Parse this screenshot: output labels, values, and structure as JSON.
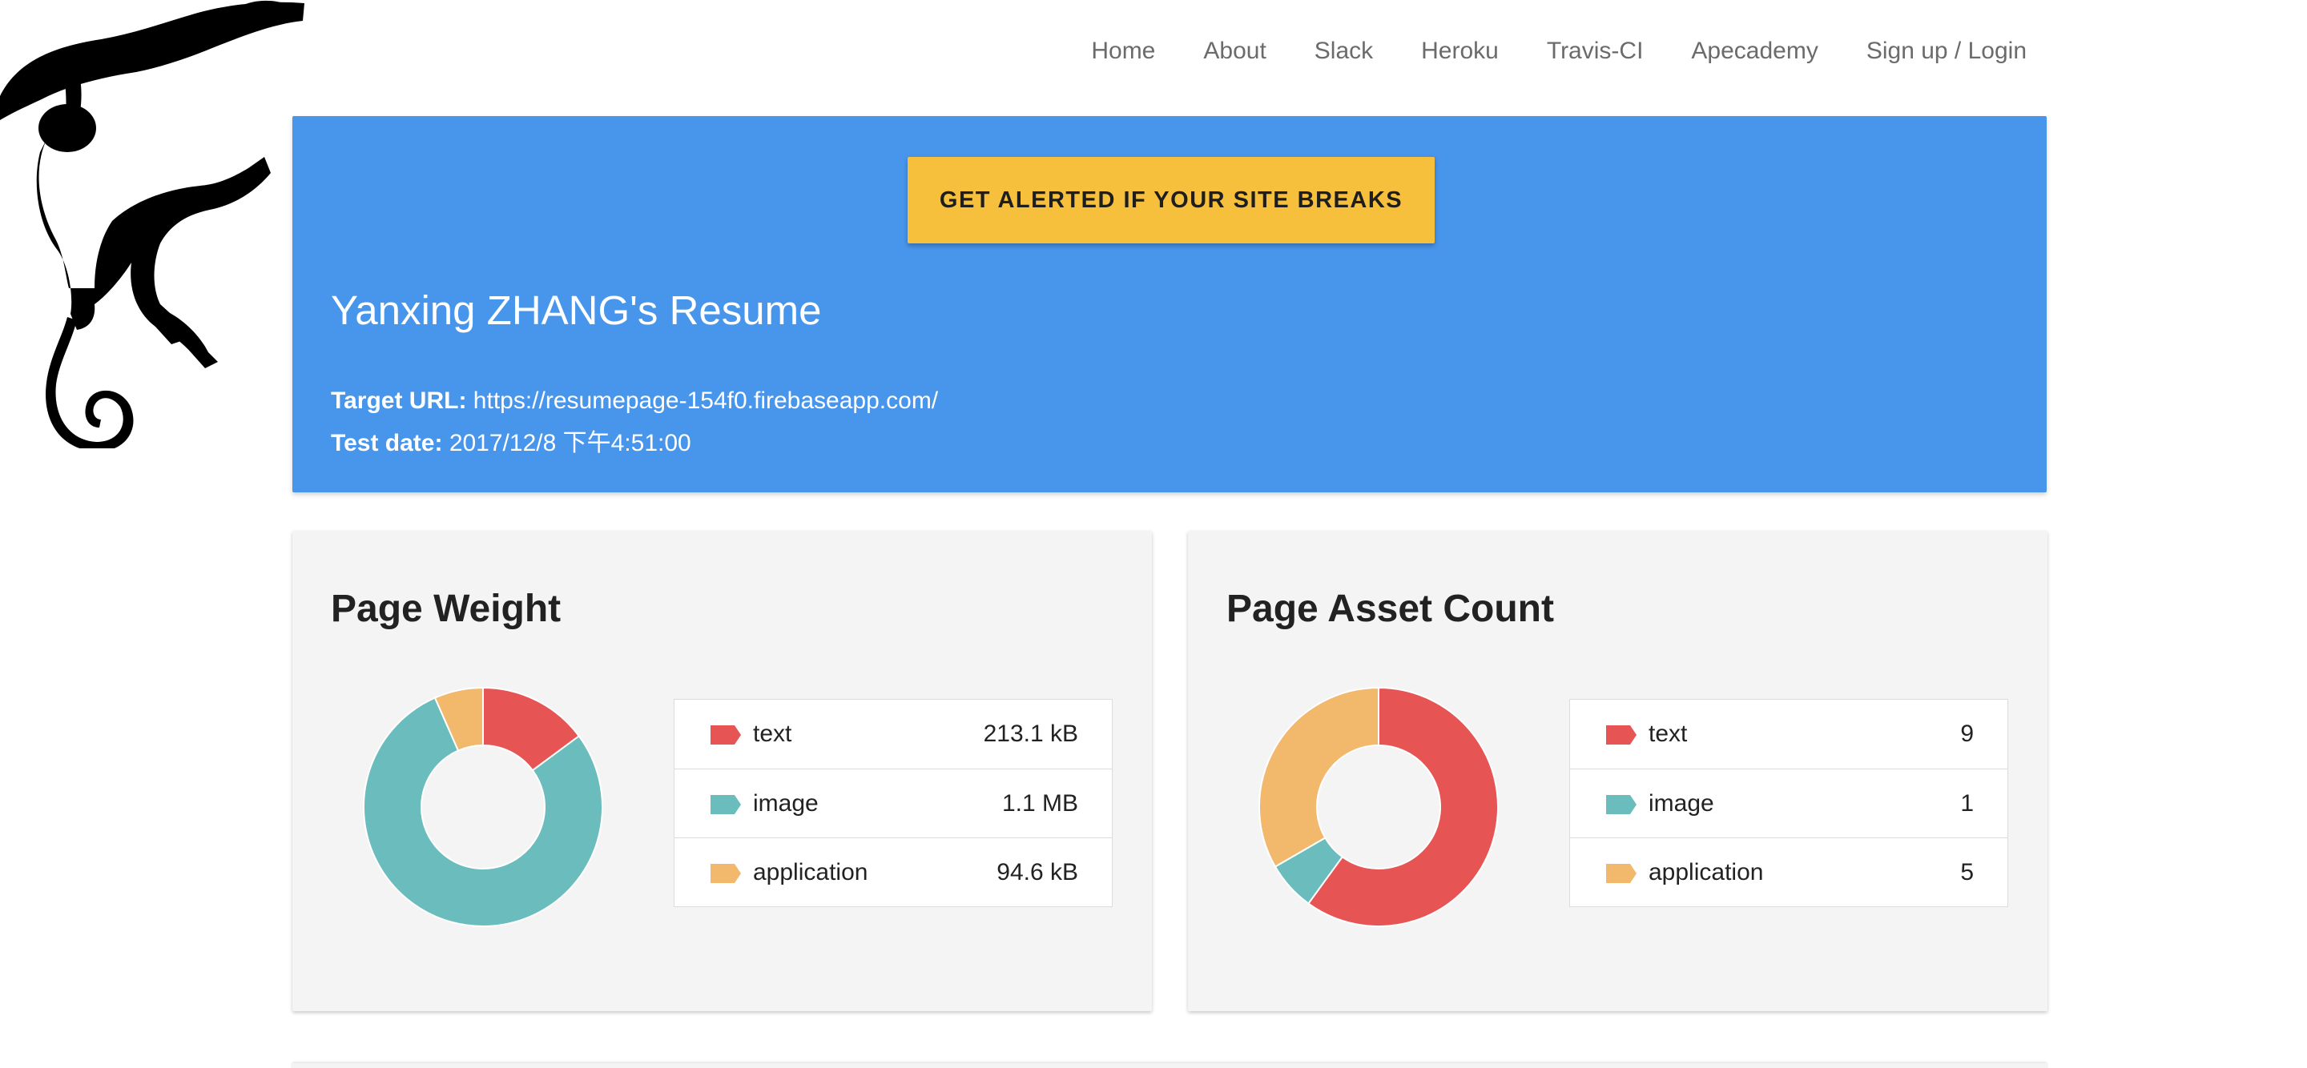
{
  "nav": {
    "items": [
      {
        "label": "Home"
      },
      {
        "label": "About"
      },
      {
        "label": "Slack"
      },
      {
        "label": "Heroku"
      },
      {
        "label": "Travis-CI"
      },
      {
        "label": "Apecademy"
      },
      {
        "label": "Sign up / Login"
      }
    ]
  },
  "hero": {
    "cta_label": "GET ALERTED IF YOUR SITE BREAKS",
    "title": "Yanxing ZHANG's Resume",
    "target_url_label": "Target URL:",
    "target_url": "https://resumepage-154f0.firebaseapp.com/",
    "test_date_label": "Test date:",
    "test_date": "2017/12/8 下午4:51:00",
    "background_color": "#4895ec",
    "cta_color": "#f7c03c"
  },
  "colors": {
    "text": "#e65454",
    "image": "#6bbdbd",
    "application": "#f2b86b"
  },
  "page_weight": {
    "title": "Page Weight",
    "rows": [
      {
        "label": "text",
        "value": "213.1 kB",
        "color": "#e65454"
      },
      {
        "label": "image",
        "value": "1.1 MB",
        "color": "#6bbdbd"
      },
      {
        "label": "application",
        "value": "94.6 kB",
        "color": "#f2b86b"
      }
    ]
  },
  "page_asset_count": {
    "title": "Page Asset Count",
    "rows": [
      {
        "label": "text",
        "value": "9",
        "color": "#e65454"
      },
      {
        "label": "image",
        "value": "1",
        "color": "#6bbdbd"
      },
      {
        "label": "application",
        "value": "5",
        "color": "#f2b86b"
      }
    ]
  },
  "chart_data": [
    {
      "type": "pie",
      "title": "Page Weight",
      "categories": [
        "text",
        "image",
        "application"
      ],
      "values": [
        213.1,
        1126.4,
        94.6
      ],
      "unit": "kB",
      "colors": [
        "#e65454",
        "#6bbdbd",
        "#f2b86b"
      ]
    },
    {
      "type": "pie",
      "title": "Page Asset Count",
      "categories": [
        "text",
        "image",
        "application"
      ],
      "values": [
        9,
        1,
        5
      ],
      "colors": [
        "#e65454",
        "#6bbdbd",
        "#f2b86b"
      ]
    }
  ]
}
